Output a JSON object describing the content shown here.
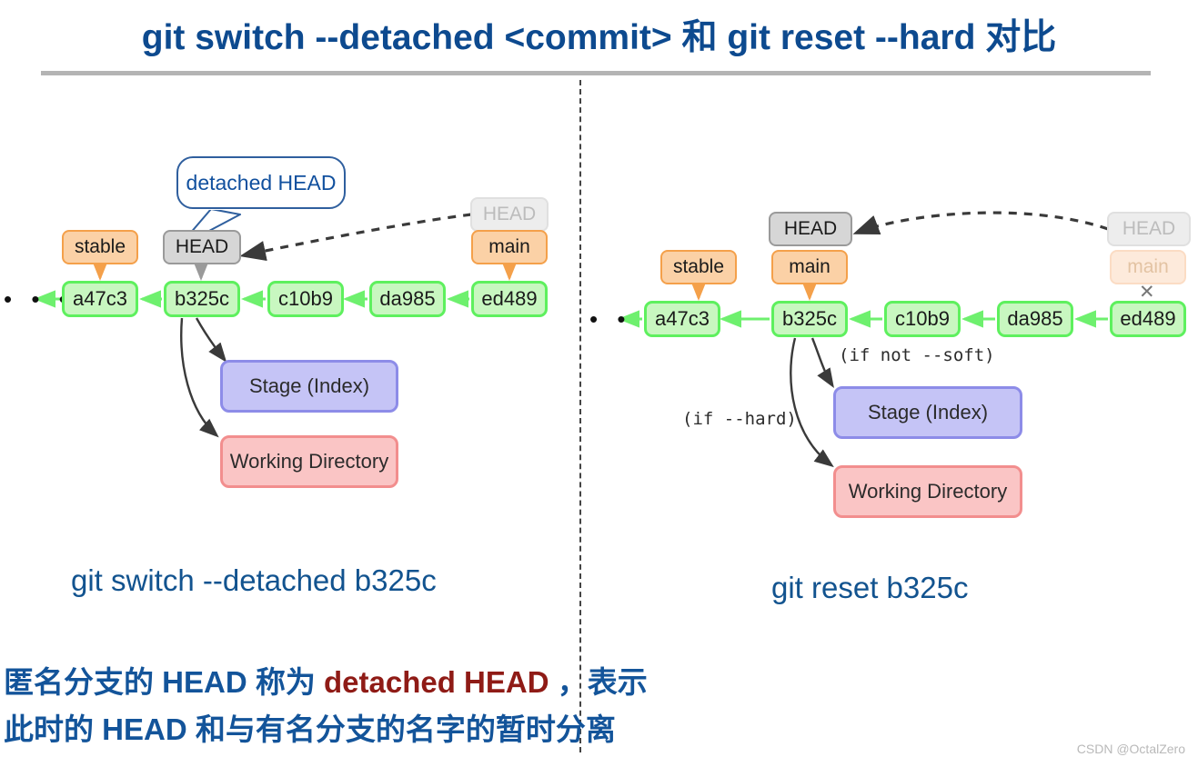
{
  "title": "git switch --detached <commit> 和 git reset --hard 对比",
  "watermark": "CSDN @OctalZero",
  "left": {
    "callout": "detached HEAD",
    "ellipsis": "• • •",
    "refs": {
      "stable": "stable",
      "head": "HEAD",
      "faded_head": "HEAD",
      "main": "main"
    },
    "commits": [
      {
        "id": "a47c3"
      },
      {
        "id": "b325c"
      },
      {
        "id": "c10b9"
      },
      {
        "id": "da985"
      },
      {
        "id": "ed489"
      }
    ],
    "stage": "Stage (Index)",
    "working_directory": "Working Directory",
    "caption": "git switch --detached  b325c"
  },
  "right": {
    "ellipsis": "• • •",
    "refs": {
      "stable": "stable",
      "head": "HEAD",
      "main": "main",
      "faded_head": "HEAD",
      "faded_main": "main",
      "cross": "✕"
    },
    "commits": [
      {
        "id": "a47c3"
      },
      {
        "id": "b325c"
      },
      {
        "id": "c10b9"
      },
      {
        "id": "da985"
      },
      {
        "id": "ed489"
      }
    ],
    "stage": "Stage (Index)",
    "working_directory": "Working Directory",
    "edge_labels": {
      "soft": "(if not --soft)",
      "hard": "(if --hard)"
    },
    "caption": "git reset  b325c"
  },
  "note": {
    "line1_a": "匿名分支的 HEAD 称为 ",
    "line1_b": "detached HEAD",
    "line1_c": " ，表示",
    "line2": "此时的 HEAD 和与有名分支的名字的暂时分离"
  },
  "colors": {
    "title": "#0d4a8f",
    "commit_fill": "#c8f7c0",
    "commit_border": "#5ef05e",
    "ref_orange_fill": "#fbd1a6",
    "ref_orange_border": "#f4a04a",
    "ref_gray_fill": "#d6d6d6",
    "stage_fill": "#c5c4f6",
    "wd_fill": "#fac5c5",
    "note_highlight": "#8f1b16"
  }
}
